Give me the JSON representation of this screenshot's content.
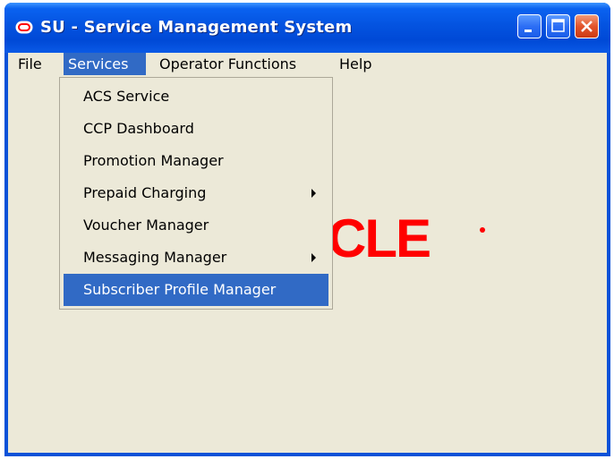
{
  "window": {
    "title": "SU - Service Management System"
  },
  "menubar": {
    "items": [
      {
        "label": "File"
      },
      {
        "label": "Services"
      },
      {
        "label": "Operator Functions"
      },
      {
        "label": "Help"
      }
    ]
  },
  "services_menu": {
    "items": [
      {
        "label": "ACS Service",
        "has_submenu": false
      },
      {
        "label": "CCP Dashboard",
        "has_submenu": false
      },
      {
        "label": "Promotion Manager",
        "has_submenu": false
      },
      {
        "label": "Prepaid Charging",
        "has_submenu": true
      },
      {
        "label": "Voucher Manager",
        "has_submenu": false
      },
      {
        "label": "Messaging Manager",
        "has_submenu": true
      },
      {
        "label": "Subscriber Profile Manager",
        "has_submenu": false,
        "highlighted": true
      }
    ]
  },
  "background": {
    "logo_visible_text": "CLE",
    "logo_color": "#ff0000"
  },
  "colors": {
    "titlebar": "#0453e0",
    "highlight": "#316ac5",
    "client_bg": "#ece9d8"
  },
  "icons": [
    "oracle-o-icon",
    "minimize-icon",
    "maximize-icon",
    "close-icon",
    "submenu-arrow-icon"
  ]
}
